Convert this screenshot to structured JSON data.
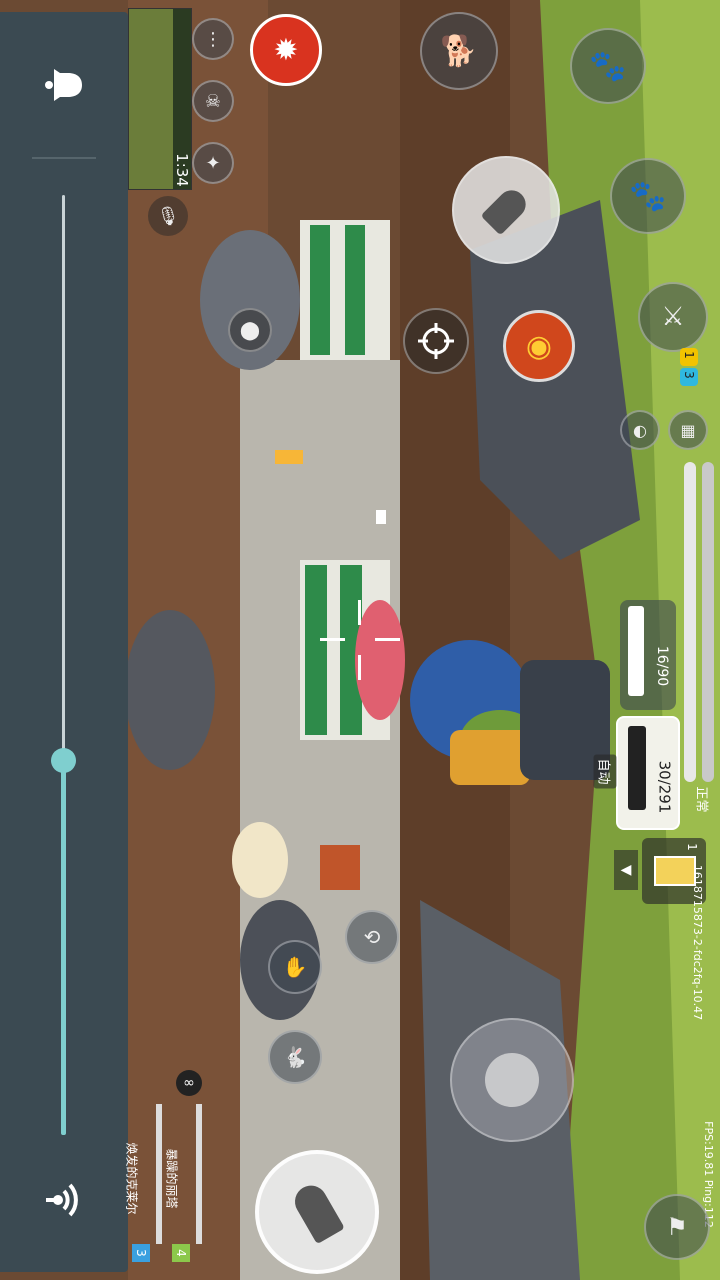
{
  "hud": {
    "match_timer": "1:34",
    "fps_ping": "FPS:19.81 Ping:112",
    "session_id": "1618715873-2-fdc2fq-10.47",
    "fire_mode": "自动",
    "stance": "正常"
  },
  "weapons": {
    "primary_ammo": "30/291",
    "secondary_ammo": "16/90"
  },
  "items": {
    "consumable_count": "1",
    "skill_charges_a": "1",
    "skill_charges_b": "3"
  },
  "team": [
    {
      "slot": "3",
      "name": "焕发的克莱尔",
      "color": "#3aa0e0"
    },
    {
      "slot": "4",
      "name": "暴躁的丽塔",
      "color": "#8cc84b"
    }
  ],
  "colors": {
    "panel": "#3b4a52",
    "volume_fill": "#7fcfcf",
    "ammo_panel": "#f2f2ea"
  }
}
